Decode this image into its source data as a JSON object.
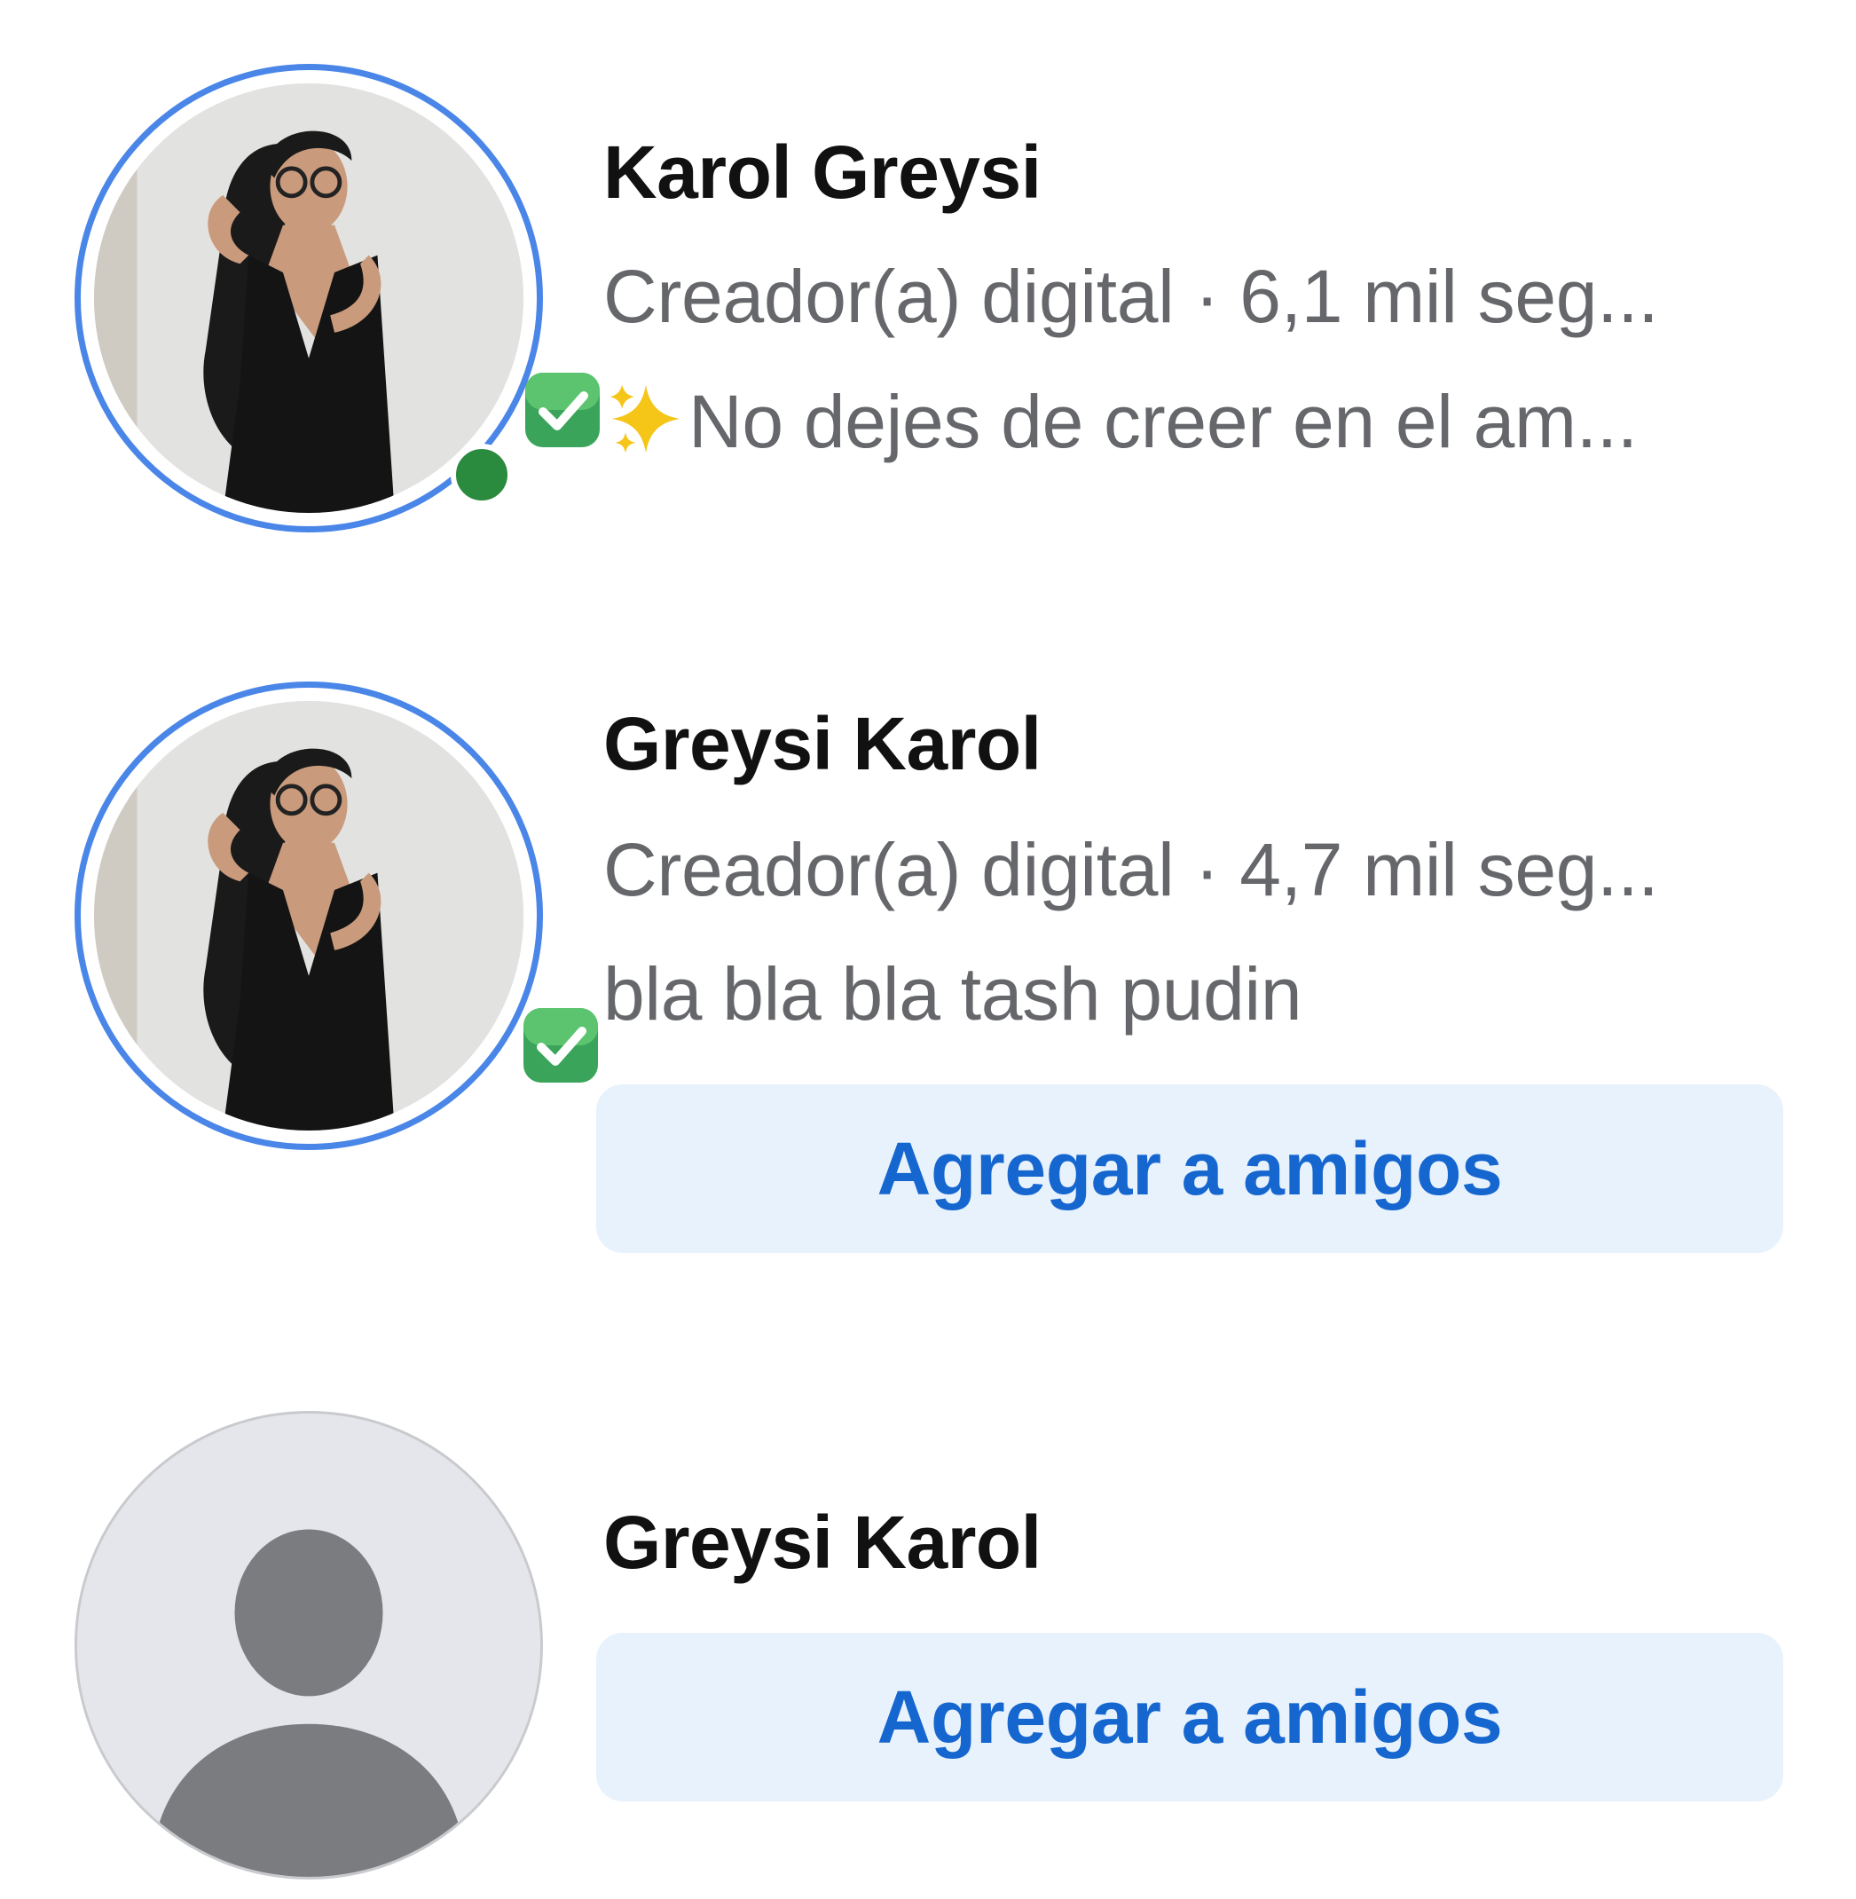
{
  "results": [
    {
      "name": "Karol Greysi",
      "line1": "Creador(a) digital · 6,1 mil seg...",
      "line2": "No dejes de creer en el am...",
      "avatar": "profile-photo",
      "verified_badge_icon": "green-check-icon",
      "line2_prefix_icon": "sparkles-icon",
      "online": true
    },
    {
      "name": "Greysi Karol",
      "line1": "Creador(a) digital · 4,7 mil seg...",
      "line2": "bla bla bla tash pudin",
      "avatar": "profile-photo",
      "verified_badge_icon": "green-check-icon",
      "button_label": "Agregar a amigos"
    },
    {
      "name": "Greysi Karol",
      "avatar": "default-avatar-icon",
      "button_label": "Agregar a amigos"
    }
  ],
  "colors": {
    "story_ring": "#4a86e8",
    "online_dot": "#2a8a3e",
    "button_bg": "#e7f2fd",
    "button_text": "#1566cf",
    "secondary_text": "#65676b"
  }
}
